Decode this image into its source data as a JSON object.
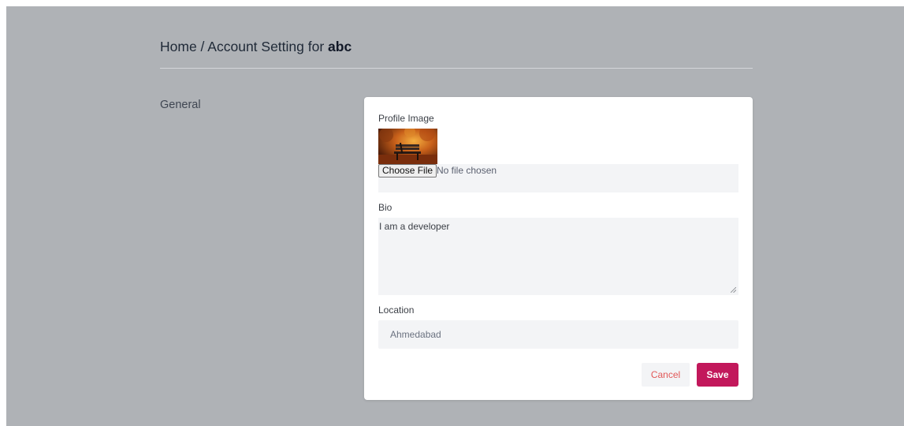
{
  "breadcrumb": {
    "prefix": "Home / Account Setting for",
    "username": "abc"
  },
  "sidebar": {
    "section": "General"
  },
  "form": {
    "profile_image": {
      "label": "Profile Image",
      "choose_button": "Choose File",
      "status": "No file chosen",
      "thumbnail": "autumn-park-bench-icon"
    },
    "bio": {
      "label": "Bio",
      "value": "I am a developer"
    },
    "location": {
      "label": "Location",
      "value": "Ahmedabad"
    },
    "actions": {
      "cancel": "Cancel",
      "save": "Save"
    }
  },
  "colors": {
    "overlay": "#afb2b6",
    "save_button": "#c2185b",
    "cancel_text": "#e25858"
  }
}
